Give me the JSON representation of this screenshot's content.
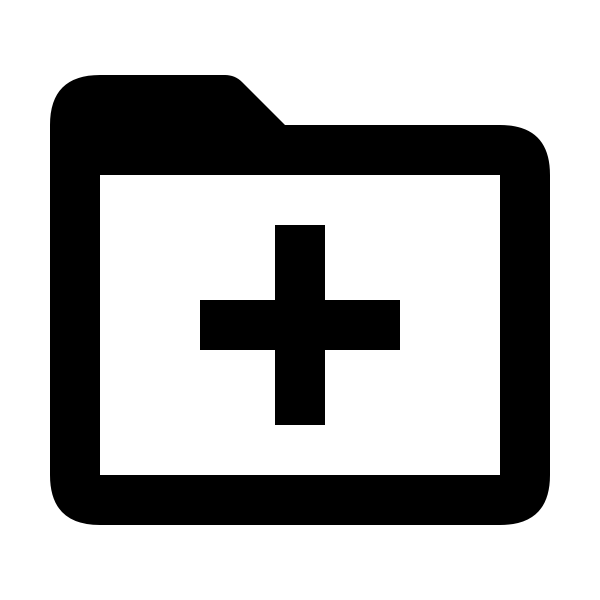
{
  "icon": {
    "name": "create-new-folder-icon",
    "fill_color": "#000000",
    "background_color": "#ffffff"
  }
}
